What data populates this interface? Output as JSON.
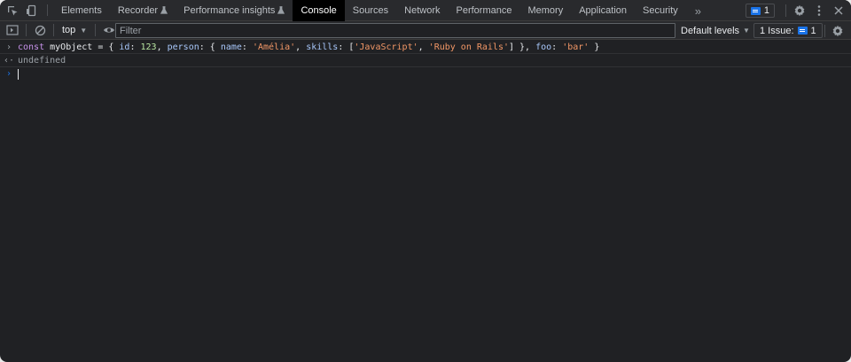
{
  "tabs": [
    {
      "label": "Elements",
      "experimental": false,
      "active": false
    },
    {
      "label": "Recorder",
      "experimental": true,
      "active": false
    },
    {
      "label": "Performance insights",
      "experimental": true,
      "active": false
    },
    {
      "label": "Console",
      "experimental": false,
      "active": true
    },
    {
      "label": "Sources",
      "experimental": false,
      "active": false
    },
    {
      "label": "Network",
      "experimental": false,
      "active": false
    },
    {
      "label": "Performance",
      "experimental": false,
      "active": false
    },
    {
      "label": "Memory",
      "experimental": false,
      "active": false
    },
    {
      "label": "Application",
      "experimental": false,
      "active": false
    },
    {
      "label": "Security",
      "experimental": false,
      "active": false
    }
  ],
  "more_tabs_symbol": "»",
  "messages_badge": {
    "count": "1",
    "icon": "message-icon"
  },
  "console_toolbar": {
    "context": "top",
    "filter_placeholder": "Filter",
    "filter_value": "",
    "levels": "Default levels",
    "issues_label": "1 Issue:",
    "issues_count": "1"
  },
  "console": {
    "input_tokens": [
      {
        "cls": "kw",
        "text": "const"
      },
      {
        "cls": "t-plain",
        "text": " myObject = { "
      },
      {
        "cls": "t-key",
        "text": "id"
      },
      {
        "cls": "t-plain",
        "text": ": "
      },
      {
        "cls": "t-num",
        "text": "123"
      },
      {
        "cls": "t-plain",
        "text": ", "
      },
      {
        "cls": "t-key",
        "text": "person"
      },
      {
        "cls": "t-plain",
        "text": ": { "
      },
      {
        "cls": "t-key",
        "text": "name"
      },
      {
        "cls": "t-plain",
        "text": ": "
      },
      {
        "cls": "t-str",
        "text": "'Amélia'"
      },
      {
        "cls": "t-plain",
        "text": ", "
      },
      {
        "cls": "t-key",
        "text": "skills"
      },
      {
        "cls": "t-plain",
        "text": ": ["
      },
      {
        "cls": "t-str",
        "text": "'JavaScript'"
      },
      {
        "cls": "t-plain",
        "text": ", "
      },
      {
        "cls": "t-str",
        "text": "'Ruby on Rails'"
      },
      {
        "cls": "t-plain",
        "text": "] }, "
      },
      {
        "cls": "t-key",
        "text": "foo"
      },
      {
        "cls": "t-plain",
        "text": ": "
      },
      {
        "cls": "t-str",
        "text": "'bar'"
      },
      {
        "cls": "t-plain",
        "text": " }"
      }
    ],
    "result": "undefined",
    "prompt_value": ""
  },
  "colors": {
    "background": "#202124",
    "toolbar": "#292a2d",
    "accent": "#1a73e8",
    "string": "#f29766",
    "number": "#b7e4a0"
  }
}
